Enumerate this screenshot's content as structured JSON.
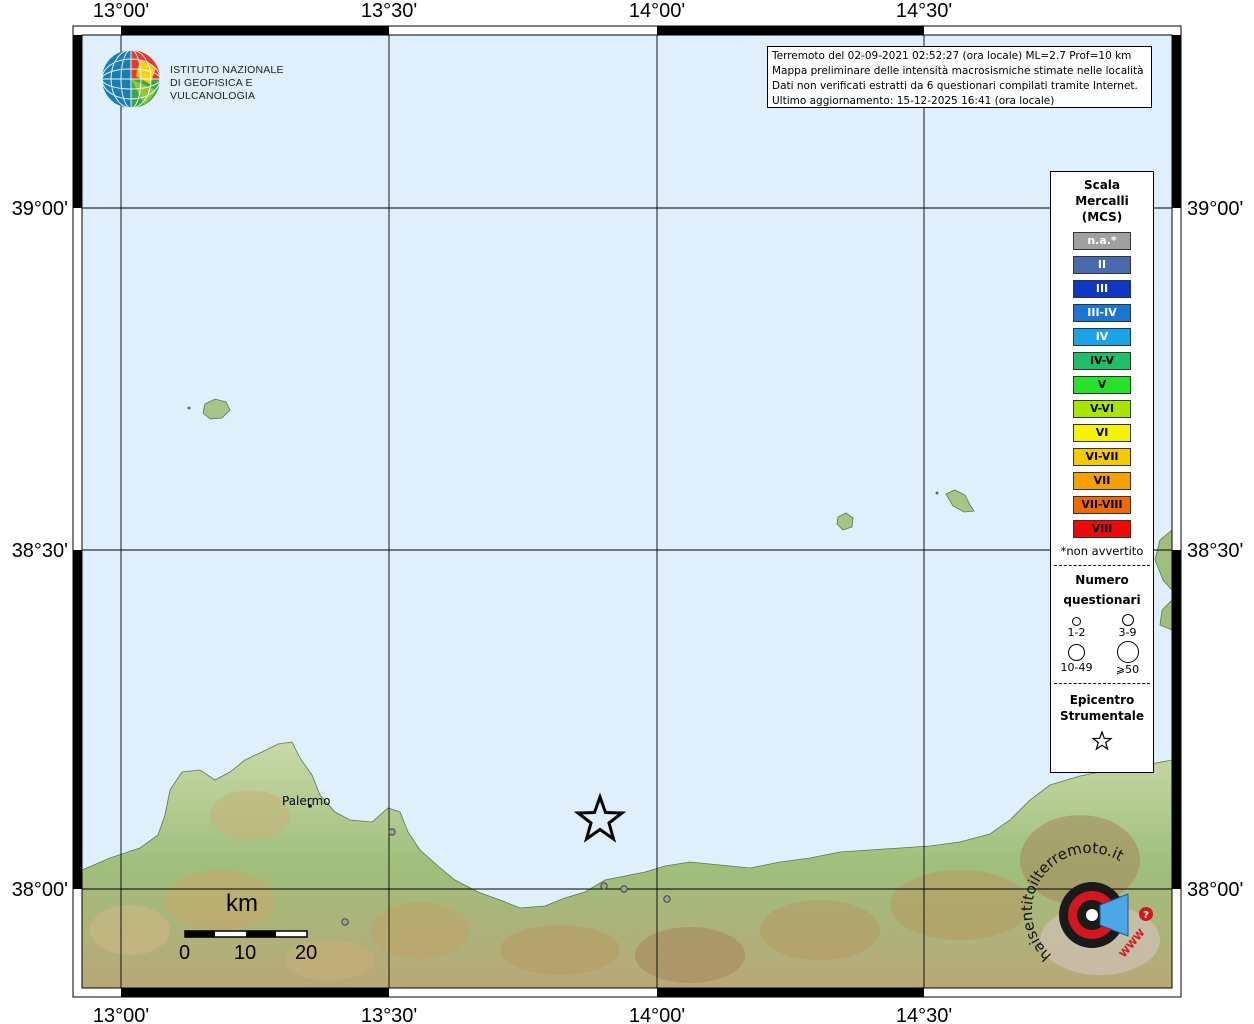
{
  "map": {
    "top_ticks": [
      "13°00'",
      "13°30'",
      "14°00'",
      "14°30'"
    ],
    "bottom_ticks": [
      "13°00'",
      "13°30'",
      "14°00'",
      "14°30'"
    ],
    "left_ticks": [
      "39°00'",
      "38°30'",
      "38°00'"
    ],
    "right_ticks": [
      "39°00'",
      "38°30'",
      "38°00'"
    ],
    "place_label": "Palermo",
    "land_color": "#9dbb7a",
    "sea_color": "#dff0fc"
  },
  "info": {
    "line1": "Terremoto del 02-09-2021 02:52:27 (ora locale) ML=2.7 Prof=10 km",
    "line2": "Mappa preliminare delle intensità macrosismiche stimate nelle località",
    "line3": "Dati non verificati estratti da 6 questionari compilati tramite Internet.",
    "line4": "Ultimo aggiornamento: 15-12-2025 16:41 (ora locale)"
  },
  "logo": {
    "line1": "ISTITUTO NAZIONALE",
    "line2": "DI GEOFISICA E VULCANOLOGIA"
  },
  "legend": {
    "title1": "Scala",
    "title2": "Mercalli",
    "title3": "(MCS)",
    "items": [
      {
        "label": "n.a.*",
        "color": "#a0a0a0",
        "text_color": "#ffffff"
      },
      {
        "label": "II",
        "color": "#4a6aae",
        "text_color": "#ffffff"
      },
      {
        "label": "III",
        "color": "#1037c4",
        "text_color": "#ffffff"
      },
      {
        "label": "III-IV",
        "color": "#1976d2",
        "text_color": "#ffffff"
      },
      {
        "label": "IV",
        "color": "#1aa3e8",
        "text_color": "#ffffff"
      },
      {
        "label": "IV-V",
        "color": "#1fbf6a",
        "text_color": "#000000"
      },
      {
        "label": "V",
        "color": "#27e12a",
        "text_color": "#000000"
      },
      {
        "label": "V-VI",
        "color": "#a8e600",
        "text_color": "#000000"
      },
      {
        "label": "VI",
        "color": "#f5f500",
        "text_color": "#000000"
      },
      {
        "label": "VI-VII",
        "color": "#f5c800",
        "text_color": "#000000"
      },
      {
        "label": "VII",
        "color": "#f5a000",
        "text_color": "#000000"
      },
      {
        "label": "VII-VIII",
        "color": "#f06a00",
        "text_color": "#000000"
      },
      {
        "label": "VIII",
        "color": "#ee0a0a",
        "text_color": "#000000"
      }
    ],
    "note": "*non avvertito",
    "numero1": "Numero",
    "numero2": "questionari",
    "circle_labels": [
      "1-2",
      "3-9",
      "10-49",
      "⩾50"
    ],
    "epicentro1": "Epicentro",
    "epicentro2": "Strumentale"
  },
  "scalebar": {
    "unit": "km",
    "ticks": [
      "0",
      "10",
      "20"
    ]
  },
  "haisentito": {
    "text": "haisentitoilterremoto.it",
    "url": "WWW"
  }
}
